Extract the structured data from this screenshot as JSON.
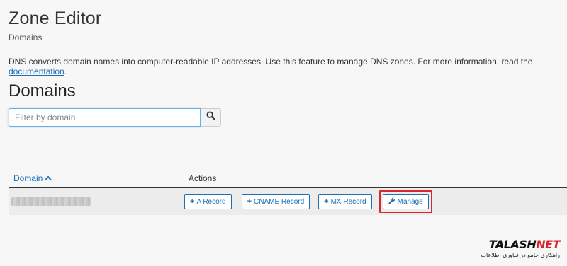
{
  "header": {
    "title": "Zone Editor",
    "breadcrumb": "Domains"
  },
  "intro": {
    "text": "DNS converts domain names into computer-readable IP addresses. Use this feature to manage DNS zones. For more information, read the ",
    "link": "documentation",
    "tail": "."
  },
  "section": {
    "title": "Domains"
  },
  "search": {
    "placeholder": "Filter by domain",
    "value": "",
    "icon": "search-icon"
  },
  "table": {
    "columns": {
      "domain": "Domain",
      "actions": "Actions"
    },
    "sort_icon": "chevron-up-icon",
    "rows": [
      {
        "domain": "",
        "actions": {
          "a_record": "A Record",
          "cname_record": "CNAME Record",
          "mx_record": "MX Record",
          "manage": "Manage"
        }
      }
    ]
  },
  "watermark": {
    "brand_dark": "TALASH",
    "brand_red": "NET",
    "tagline": "راهکاری جامع در فناوری اطلاعات"
  },
  "colors": {
    "link": "#1a6fb5",
    "highlight": "#d9262c",
    "background": "#f7f7f7"
  }
}
